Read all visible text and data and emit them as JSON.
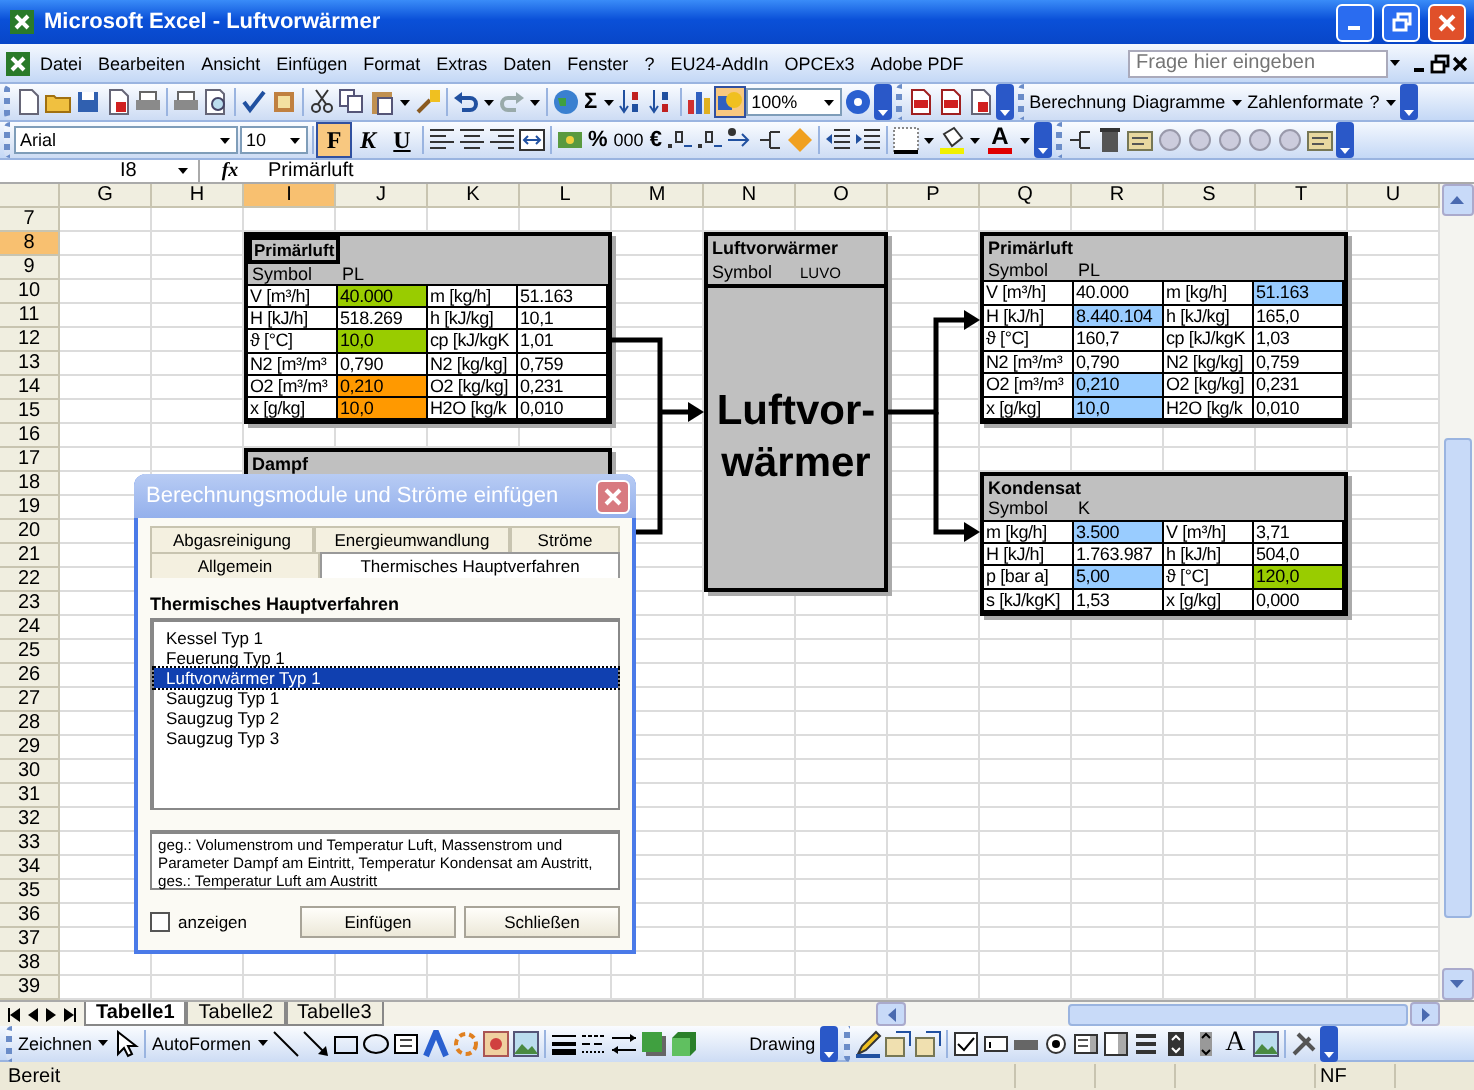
{
  "window": {
    "title": "Microsoft Excel - Luftvorwärmer"
  },
  "menu": [
    "Datei",
    "Bearbeiten",
    "Ansicht",
    "Einfügen",
    "Format",
    "Extras",
    "Daten",
    "Fenster",
    "?",
    "EU24-AddIn",
    "OPCEx3",
    "Adobe PDF"
  ],
  "help_search": {
    "placeholder": "Frage hier eingeben"
  },
  "standard_toolbar": {
    "sum": "Σ",
    "zoom": "100%",
    "drawing_active": true
  },
  "addin_toolbar": [
    "Berechnung",
    "Diagramme",
    "Zahlenformate",
    "?"
  ],
  "format_toolbar": {
    "font": "Arial",
    "size": "10",
    "percent": "%",
    "thousands": "000",
    "euro": "€",
    "font_color": "A"
  },
  "format_buttons": [
    {
      "label": "F",
      "pressed": true
    },
    {
      "label": "K",
      "pressed": false
    },
    {
      "label": "U",
      "pressed": false
    }
  ],
  "formula_bar": {
    "name_box": "I8",
    "fx": "fx",
    "content": "Primärluft"
  },
  "columns": [
    {
      "label": "G",
      "selected": false
    },
    {
      "label": "H",
      "selected": false
    },
    {
      "label": "I",
      "selected": true
    },
    {
      "label": "J",
      "selected": false
    },
    {
      "label": "K",
      "selected": false
    },
    {
      "label": "L",
      "selected": false
    },
    {
      "label": "M",
      "selected": false
    },
    {
      "label": "N",
      "selected": false
    },
    {
      "label": "O",
      "selected": false
    },
    {
      "label": "P",
      "selected": false
    },
    {
      "label": "Q",
      "selected": false
    },
    {
      "label": "R",
      "selected": false
    },
    {
      "label": "S",
      "selected": false
    },
    {
      "label": "T",
      "selected": false
    },
    {
      "label": "U",
      "selected": false
    }
  ],
  "rows": [
    {
      "label": "7",
      "selected": false
    },
    {
      "label": "8",
      "selected": true
    },
    {
      "label": "9",
      "selected": false
    },
    {
      "label": "10",
      "selected": false
    },
    {
      "label": "11",
      "selected": false
    },
    {
      "label": "12",
      "selected": false
    },
    {
      "label": "13",
      "selected": false
    },
    {
      "label": "14",
      "selected": false
    },
    {
      "label": "15",
      "selected": false
    },
    {
      "label": "16",
      "selected": false
    },
    {
      "label": "17",
      "selected": false
    },
    {
      "label": "18",
      "selected": false
    },
    {
      "label": "19",
      "selected": false
    },
    {
      "label": "20",
      "selected": false
    },
    {
      "label": "21",
      "selected": false
    },
    {
      "label": "22",
      "selected": false
    },
    {
      "label": "23",
      "selected": false
    },
    {
      "label": "24",
      "selected": false
    },
    {
      "label": "25",
      "selected": false
    },
    {
      "label": "26",
      "selected": false
    },
    {
      "label": "27",
      "selected": false
    },
    {
      "label": "28",
      "selected": false
    },
    {
      "label": "29",
      "selected": false
    },
    {
      "label": "30",
      "selected": false
    },
    {
      "label": "31",
      "selected": false
    },
    {
      "label": "32",
      "selected": false
    },
    {
      "label": "33",
      "selected": false
    },
    {
      "label": "34",
      "selected": false
    },
    {
      "label": "35",
      "selected": false
    },
    {
      "label": "36",
      "selected": false
    },
    {
      "label": "37",
      "selected": false
    },
    {
      "label": "38",
      "selected": false
    },
    {
      "label": "39",
      "selected": false
    }
  ],
  "stream_tables": [
    {
      "title": "Primärluft",
      "symbol_label": "Symbol",
      "symbol": "PL",
      "rows": [
        [
          {
            "text": "V [m³/h]"
          },
          {
            "text": "40.000",
            "color": "#99cc00"
          },
          {
            "text": "m [kg/h]"
          },
          {
            "text": "51.163"
          }
        ],
        [
          {
            "text": "H [kJ/h]"
          },
          {
            "text": "518.269"
          },
          {
            "text": "h [kJ/kg]"
          },
          {
            "text": "10,1"
          }
        ],
        [
          {
            "text": "ϑ [°C]"
          },
          {
            "text": "10,0",
            "color": "#99cc00"
          },
          {
            "text": "cp [kJ/kgK"
          },
          {
            "text": "1,01"
          }
        ],
        [
          {
            "text": "N2 [m³/m³"
          },
          {
            "text": "0,790"
          },
          {
            "text": "N2 [kg/kg]"
          },
          {
            "text": "0,759"
          }
        ],
        [
          {
            "text": "O2 [m³/m³"
          },
          {
            "text": "0,210",
            "color": "#ff9900"
          },
          {
            "text": "O2 [kg/kg]"
          },
          {
            "text": "0,231"
          }
        ],
        [
          {
            "text": "x [g/kg]"
          },
          {
            "text": "10,0",
            "color": "#ff9900"
          },
          {
            "text": "H2O [kg/k"
          },
          {
            "text": "0,010"
          }
        ]
      ]
    },
    {
      "title": "Primärluft",
      "symbol_label": "Symbol",
      "symbol": "PL",
      "rows": [
        [
          {
            "text": "V [m³/h]"
          },
          {
            "text": "40.000"
          },
          {
            "text": "m [kg/h]"
          },
          {
            "text": "51.163",
            "color": "#99ccff"
          }
        ],
        [
          {
            "text": "H [kJ/h]"
          },
          {
            "text": "8.440.104",
            "color": "#99ccff"
          },
          {
            "text": "h [kJ/kg]"
          },
          {
            "text": "165,0"
          }
        ],
        [
          {
            "text": "ϑ [°C]"
          },
          {
            "text": "160,7"
          },
          {
            "text": "cp [kJ/kgK"
          },
          {
            "text": "1,03"
          }
        ],
        [
          {
            "text": "N2 [m³/m³"
          },
          {
            "text": "0,790"
          },
          {
            "text": "N2 [kg/kg]"
          },
          {
            "text": "0,759"
          }
        ],
        [
          {
            "text": "O2 [m³/m³"
          },
          {
            "text": "0,210",
            "color": "#99ccff"
          },
          {
            "text": "O2 [kg/kg]"
          },
          {
            "text": "0,231"
          }
        ],
        [
          {
            "text": "x [g/kg]"
          },
          {
            "text": "10,0",
            "color": "#99ccff"
          },
          {
            "text": "H2O [kg/k"
          },
          {
            "text": "0,010"
          }
        ]
      ]
    },
    {
      "title": "Dampf"
    },
    {
      "title": "Kondensat",
      "symbol_label": "Symbol",
      "symbol": "K",
      "rows": [
        [
          {
            "text": "m [kg/h]"
          },
          {
            "text": "3.500",
            "color": "#99ccff"
          },
          {
            "text": "V [m³/h]"
          },
          {
            "text": "3,71"
          }
        ],
        [
          {
            "text": "H [kJ/h]"
          },
          {
            "text": "1.763.987"
          },
          {
            "text": "h [kJ/h]"
          },
          {
            "text": "504,0"
          }
        ],
        [
          {
            "text": "p [bar a]"
          },
          {
            "text": "5,00",
            "color": "#99ccff"
          },
          {
            "text": "ϑ [°C]"
          },
          {
            "text": "120,0",
            "color": "#99cc00"
          }
        ],
        [
          {
            "text": "s [kJ/kgK]"
          },
          {
            "text": "1,53"
          },
          {
            "text": "x [g/kg]"
          },
          {
            "text": "0,000"
          }
        ]
      ]
    }
  ],
  "module": {
    "title": "Luftvorwärmer",
    "symbol_label": "Symbol",
    "symbol": "LUVO",
    "label": "Luftvor-wärmer"
  },
  "dialog": {
    "title": "Berechnungsmodule und Ströme einfügen",
    "tab_rows": [
      [
        {
          "label": "Abgasreinigung",
          "selected": false
        },
        {
          "label": "Energieumwandlung",
          "selected": false
        },
        {
          "label": "Ströme",
          "selected": false
        }
      ],
      [
        {
          "label": "Allgemein",
          "selected": false
        },
        {
          "label": "Thermisches Hauptverfahren",
          "selected": true
        }
      ]
    ],
    "list_heading": "Thermisches Hauptverfahren",
    "items": [
      {
        "label": "Kessel Typ 1",
        "selected": false
      },
      {
        "label": "Feuerung Typ 1",
        "selected": false
      },
      {
        "label": "Luftvorwärmer Typ 1",
        "selected": true
      },
      {
        "label": "Saugzug Typ 1",
        "selected": false
      },
      {
        "label": "Saugzug Typ 2",
        "selected": false
      },
      {
        "label": "Saugzug Typ 3",
        "selected": false
      }
    ],
    "description": "geg.: Volumenstrom und Temperatur Luft, Massenstrom und Parameter Dampf am Eintritt, Temperatur Kondensat am Austritt, ges.: Temperatur Luft am Austritt",
    "checkbox": {
      "label": "anzeigen",
      "checked": false
    },
    "buttons": [
      "Einfügen",
      "Schließen"
    ]
  },
  "sheet_tabs": [
    {
      "label": "Tabelle1",
      "selected": true
    },
    {
      "label": "Tabelle2",
      "selected": false
    },
    {
      "label": "Tabelle3",
      "selected": false
    }
  ],
  "drawing_toolbar": {
    "menu": "Zeichnen",
    "autoshapes": "AutoFormen",
    "drawing": "Drawing",
    "label_letter": "A"
  },
  "status_bar": {
    "text": "Bereit",
    "indicator": "NF"
  }
}
